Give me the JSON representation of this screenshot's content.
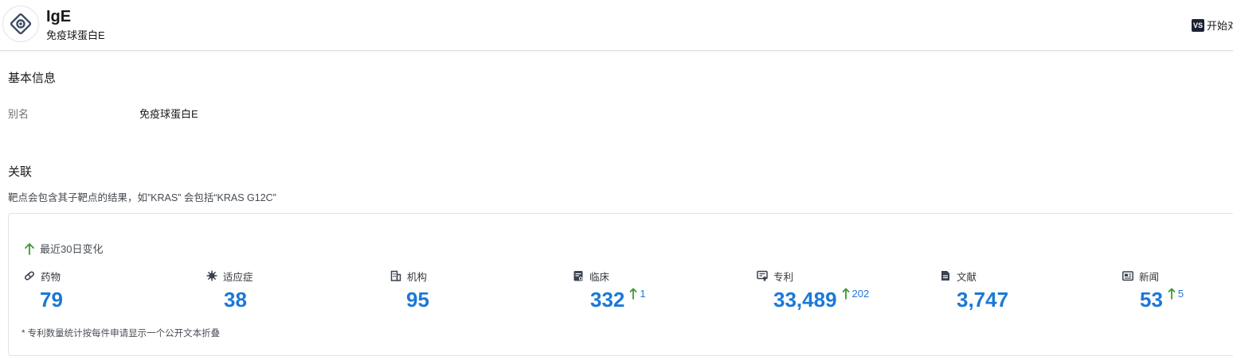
{
  "header": {
    "title": "IgE",
    "subtitle": "免疫球蛋白E",
    "action_badge": "VS",
    "action_label": "开始对"
  },
  "basic_info": {
    "section_title": "基本信息",
    "alias_label": "别名",
    "alias_value": "免疫球蛋白E"
  },
  "relations": {
    "section_title": "关联",
    "description": "靶点会包含其子靶点的结果，如”KRAS” 会包括“KRAS G12C”",
    "change_label": "最近30日变化",
    "footnote": "* 专利数量统计按每件申请显示一个公开文本折叠",
    "stats": [
      {
        "label": "药物",
        "icon": "pill-icon",
        "value": "79",
        "delta": null
      },
      {
        "label": "适应症",
        "icon": "virus-icon",
        "value": "38",
        "delta": null
      },
      {
        "label": "机构",
        "icon": "building-icon",
        "value": "95",
        "delta": null
      },
      {
        "label": "临床",
        "icon": "clipboard-icon",
        "value": "332",
        "delta": "1"
      },
      {
        "label": "专利",
        "icon": "certificate-icon",
        "value": "33,489",
        "delta": "202"
      },
      {
        "label": "文献",
        "icon": "document-icon",
        "value": "3,747",
        "delta": null
      },
      {
        "label": "新闻",
        "icon": "newspaper-icon",
        "value": "53",
        "delta": "5"
      }
    ]
  },
  "colors": {
    "accent_blue": "#1c78d6",
    "increase_green": "#3a9a2e",
    "badge_dark": "#1b2333"
  }
}
